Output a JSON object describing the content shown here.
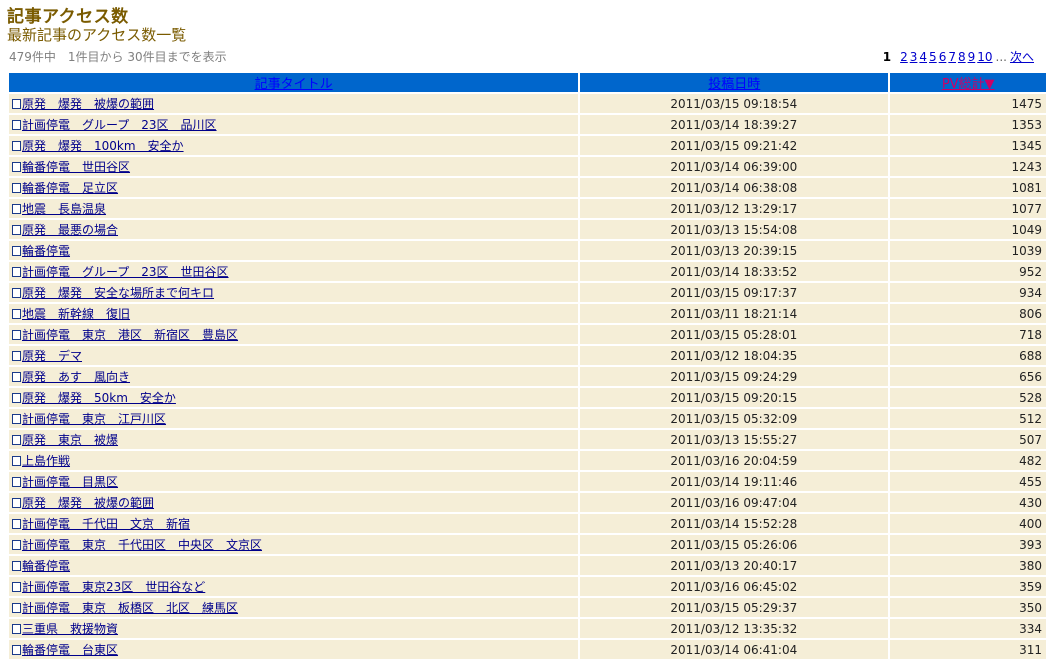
{
  "header": {
    "title": "記事アクセス数",
    "subtitle": "最新記事のアクセス数一覧",
    "result_info": "479件中　1件目から 30件目までを表示"
  },
  "pager": {
    "current": "1",
    "pages": [
      "2",
      "3",
      "4",
      "5",
      "6",
      "7",
      "8",
      "9",
      "10"
    ],
    "ellipsis": "...",
    "next_label": "次へ"
  },
  "table": {
    "columns": {
      "title": "記事タイトル",
      "date": "投稿日時",
      "pv": "PV総計▼"
    },
    "rows": [
      {
        "title": "原発　爆発　被爆の範囲",
        "date": "2011/03/15 09:18:54",
        "pv": "1475"
      },
      {
        "title": "計画停電　グループ　23区　品川区",
        "date": "2011/03/14 18:39:27",
        "pv": "1353"
      },
      {
        "title": "原発　爆発　100km　安全か",
        "date": "2011/03/15 09:21:42",
        "pv": "1345"
      },
      {
        "title": "輪番停電　世田谷区",
        "date": "2011/03/14 06:39:00",
        "pv": "1243"
      },
      {
        "title": "輪番停電　足立区",
        "date": "2011/03/14 06:38:08",
        "pv": "1081"
      },
      {
        "title": "地震　長島温泉",
        "date": "2011/03/12 13:29:17",
        "pv": "1077"
      },
      {
        "title": "原発　最悪の場合",
        "date": "2011/03/13 15:54:08",
        "pv": "1049"
      },
      {
        "title": "輪番停電",
        "date": "2011/03/13 20:39:15",
        "pv": "1039"
      },
      {
        "title": "計画停電　グループ　23区　世田谷区",
        "date": "2011/03/14 18:33:52",
        "pv": "952"
      },
      {
        "title": "原発　爆発　安全な場所まで何キロ",
        "date": "2011/03/15 09:17:37",
        "pv": "934"
      },
      {
        "title": "地震　新幹線　復旧",
        "date": "2011/03/11 18:21:14",
        "pv": "806"
      },
      {
        "title": "計画停電　東京　港区　新宿区　豊島区",
        "date": "2011/03/15 05:28:01",
        "pv": "718"
      },
      {
        "title": "原発　デマ",
        "date": "2011/03/12 18:04:35",
        "pv": "688"
      },
      {
        "title": "原発　あす　風向き",
        "date": "2011/03/15 09:24:29",
        "pv": "656"
      },
      {
        "title": "原発　爆発　50km　安全か",
        "date": "2011/03/15 09:20:15",
        "pv": "528"
      },
      {
        "title": "計画停電　東京　江戸川区",
        "date": "2011/03/15 05:32:09",
        "pv": "512"
      },
      {
        "title": "原発　東京　被爆",
        "date": "2011/03/13 15:55:27",
        "pv": "507"
      },
      {
        "title": "上島作戦",
        "date": "2011/03/16 20:04:59",
        "pv": "482"
      },
      {
        "title": "計画停電　目黒区",
        "date": "2011/03/14 19:11:46",
        "pv": "455"
      },
      {
        "title": "原発　爆発　被爆の範囲",
        "date": "2011/03/16 09:47:04",
        "pv": "430"
      },
      {
        "title": "計画停電　千代田　文京　新宿",
        "date": "2011/03/14 15:52:28",
        "pv": "400"
      },
      {
        "title": "計画停電　東京　千代田区　中央区　文京区",
        "date": "2011/03/15 05:26:06",
        "pv": "393"
      },
      {
        "title": "輪番停電",
        "date": "2011/03/13 20:40:17",
        "pv": "380"
      },
      {
        "title": "計画停電　東京23区　世田谷など",
        "date": "2011/03/16 06:45:02",
        "pv": "359"
      },
      {
        "title": "計画停電　東京　板橋区　北区　練馬区",
        "date": "2011/03/15 05:29:37",
        "pv": "350"
      },
      {
        "title": "三重県　救援物資",
        "date": "2011/03/12 13:35:32",
        "pv": "334"
      },
      {
        "title": "輪番停電　台東区",
        "date": "2011/03/14 06:41:04",
        "pv": "311"
      }
    ]
  },
  "colors": {
    "title_brown": "#7a5b00",
    "header_blue": "#0066cc",
    "row_beige": "#f5eed7",
    "link_blue": "#0000ff",
    "sorted_pink": "#cc0066"
  },
  "icons": {
    "row_icon": "page-icon"
  }
}
